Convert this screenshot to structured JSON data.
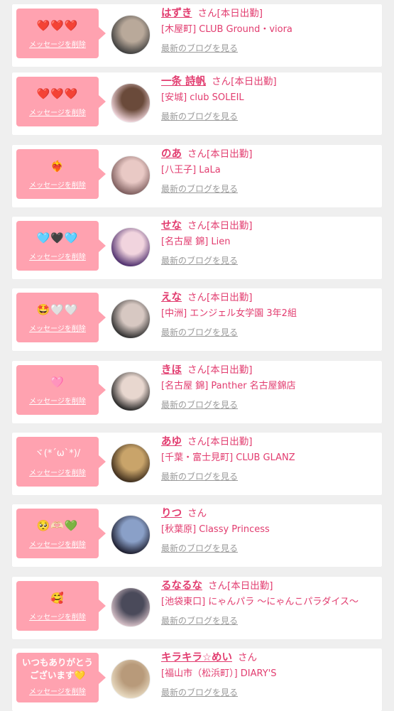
{
  "delete_label": "メッセージを削除",
  "blog_label": "最新のブログを見る",
  "honorific": "さん",
  "colors": {
    "accent": "#e23c6f",
    "bubble": "#ffa2b0",
    "link_gray": "#9a9a9a",
    "background": "#efefef"
  },
  "cards": [
    {
      "message": "❤️❤️❤️",
      "name": "はずき",
      "status": "[本日出勤]",
      "shop": "[木屋町] CLUB Ground・viora",
      "avatar_colors": [
        "#3b3b3b",
        "#b9a99a"
      ]
    },
    {
      "message": "❤️❤️❤️",
      "name": "一条 詩帆",
      "status": "[本日出勤]",
      "shop": "[安城] club SOLEIL",
      "avatar_colors": [
        "#f4d9e0",
        "#6a4a3a"
      ]
    },
    {
      "message": "❤️‍🔥",
      "name": "のあ",
      "status": "[本日出勤]",
      "shop": "[八王子] LaLa",
      "avatar_colors": [
        "#7a5a5a",
        "#e9c9c5"
      ]
    },
    {
      "message": "🩵🖤🩵",
      "name": "せな",
      "status": "[本日出勤]",
      "shop": "[名古屋 錦] Lien",
      "avatar_colors": [
        "#4a2a6a",
        "#f1d4de"
      ]
    },
    {
      "message": "🤩🤍🤍",
      "name": "えな",
      "status": "[本日出勤]",
      "shop": "[中洲] エンジェル女学園 3年2組",
      "avatar_colors": [
        "#2c2c2c",
        "#d7c8c2"
      ]
    },
    {
      "message": "🩷",
      "name": "きほ",
      "status": "[本日出勤]",
      "shop": "[名古屋 錦] Panther 名古屋錦店",
      "avatar_colors": [
        "#222222",
        "#e8d7cf"
      ]
    },
    {
      "message": "ヾ(*´ω`*)/",
      "name": "あゆ",
      "status": "[本日出勤]",
      "shop": "[千葉・富士見町] CLUB GLANZ",
      "avatar_colors": [
        "#3a2a1a",
        "#c9a46a"
      ]
    },
    {
      "message": "🥺🫶🏻💚",
      "name": "りつ",
      "status": "",
      "shop": "[秋葉原] Classy Princess",
      "avatar_colors": [
        "#1a1a2a",
        "#8aa0c8"
      ]
    },
    {
      "message": "🥰",
      "name": "るなるな",
      "status": "[本日出勤]",
      "shop": "[池袋東口] にゃんパラ 〜にゃんこパラダイス〜",
      "avatar_colors": [
        "#d9c2c9",
        "#4a4a5a"
      ]
    },
    {
      "message": "いつもありがとうございます💛",
      "name": "キラキラ☆めい",
      "status": "",
      "shop": "[福山市（松浜町）] DIARY'S",
      "avatar_colors": [
        "#e9dcc3",
        "#b89a7a"
      ]
    }
  ]
}
